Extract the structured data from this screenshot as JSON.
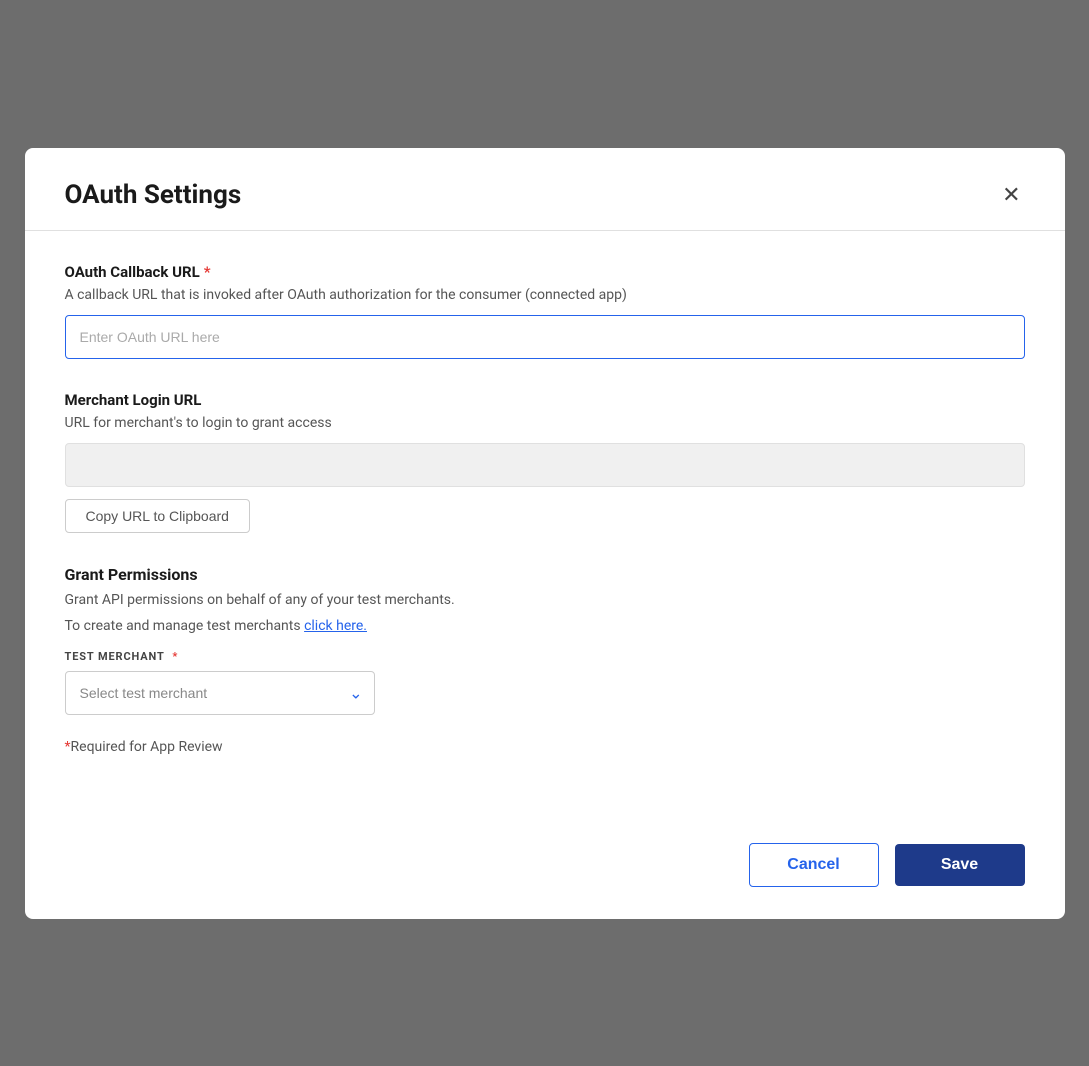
{
  "modal": {
    "title": "OAuth Settings",
    "close_icon": "×",
    "sections": {
      "oauth_callback": {
        "label": "OAuth Callback URL",
        "required": true,
        "description": "A callback URL that is invoked after OAuth authorization for the consumer (connected app)",
        "input_placeholder": "Enter OAuth URL here"
      },
      "merchant_login": {
        "label": "Merchant Login URL",
        "required": false,
        "description": "URL for merchant's to login to grant access",
        "input_value": "",
        "copy_button_label": "Copy URL to Clipboard"
      },
      "grant_permissions": {
        "title": "Grant Permissions",
        "description": "Grant API permissions on behalf of any of your test merchants.",
        "link_text_prefix": "To create and manage test merchants ",
        "link_text": "click here.",
        "sub_label": "TEST MERCHANT",
        "required": true,
        "select_placeholder": "Select test merchant",
        "select_options": []
      }
    },
    "required_note": "*Required for App Review",
    "footer": {
      "cancel_label": "Cancel",
      "save_label": "Save"
    }
  }
}
